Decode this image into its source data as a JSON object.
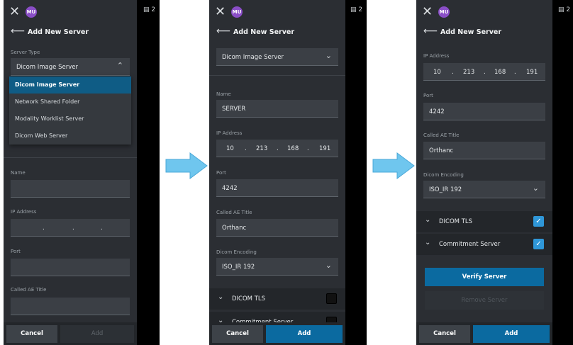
{
  "common": {
    "avatar": "MU",
    "close": "✕",
    "back": "⟵",
    "title": "Add New Server",
    "cancel": "Cancel",
    "add": "Add",
    "badge": "2",
    "icons": [
      "close-icon",
      "back-arrow-icon",
      "chevron-down-icon",
      "chevron-up-icon",
      "checkbox-icon",
      "right-arrow-icon"
    ],
    "accent": "#0b6aa0"
  },
  "screen1": {
    "server_type_label": "Server Type",
    "server_type_value": "Dicom Image Server",
    "options": [
      "Dicom Image Server",
      "Network Shared Folder",
      "Modality Worklist Server",
      "Dicom Web Server"
    ],
    "name_label": "Name",
    "ip_label": "IP Address",
    "port_label": "Port",
    "aet_label": "Called AE Title"
  },
  "screen2": {
    "server_type_value": "Dicom Image Server",
    "name_label": "Name",
    "name_value": "SERVER",
    "ip_label": "IP Address",
    "ip": [
      "10",
      "213",
      "168",
      "191"
    ],
    "port_label": "Port",
    "port_value": "4242",
    "aet_label": "Called AE Title",
    "aet_value": "Orthanc",
    "enc_label": "Dicom Encoding",
    "enc_value": "ISO_IR 192",
    "dicom_tls": "DICOM TLS",
    "commitment": "Commitment Server"
  },
  "screen3": {
    "ip_label": "IP Address",
    "ip": [
      "10",
      "213",
      "168",
      "191"
    ],
    "port_label": "Port",
    "port_value": "4242",
    "aet_label": "Called AE Title",
    "aet_value": "Orthanc",
    "enc_label": "Dicom Encoding",
    "enc_value": "ISO_IR 192",
    "dicom_tls": "DICOM TLS",
    "commitment": "Commitment Server",
    "verify": "Verify Server",
    "remove": "Remove Server"
  }
}
